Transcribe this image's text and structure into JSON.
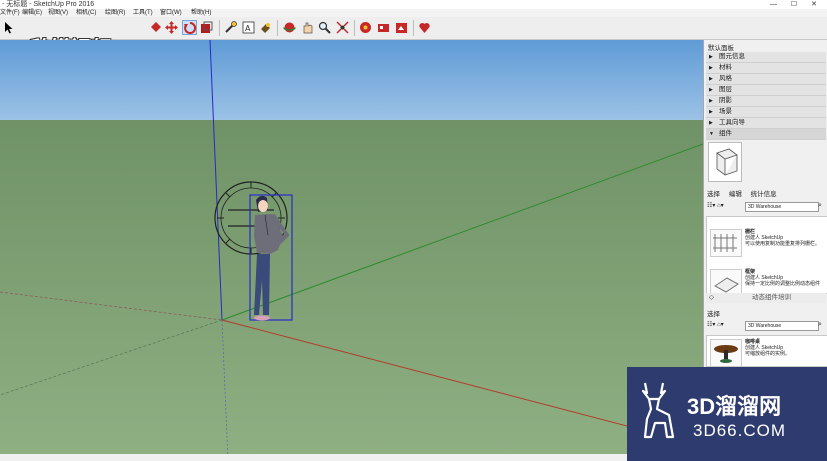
{
  "window": {
    "title": "- 无标题 - SketchUp Pro 2016"
  },
  "menu": {
    "items": [
      "文件(F)",
      "编辑(E)",
      "视图(V)",
      "相机(C)",
      "绘图(R)",
      "工具(T)",
      "窗口(W)",
      "帮助(H)"
    ]
  },
  "toolbar": {
    "logo_text": "秒懂视频",
    "tools": [
      "select-icon",
      "eraser-icon",
      "paint-bucket-icon",
      "move-icon",
      "rotate-icon",
      "scale-icon",
      "tape-measure-icon",
      "text-icon",
      "paint-icon",
      "orbit-icon",
      "pan-icon",
      "zoom-icon",
      "zoom-extents-icon",
      "warehouse-icon",
      "extension-icon",
      "share-icon",
      "layout-icon"
    ]
  },
  "panel": {
    "title": "默认面板",
    "trays": [
      {
        "label": "图元信息",
        "open": false
      },
      {
        "label": "材料",
        "open": false
      },
      {
        "label": "风格",
        "open": false
      },
      {
        "label": "图层",
        "open": false
      },
      {
        "label": "阴影",
        "open": false
      },
      {
        "label": "场景",
        "open": false
      },
      {
        "label": "工具向导",
        "open": false
      },
      {
        "label": "组件",
        "open": true
      }
    ],
    "tabs": [
      "选择",
      "编辑",
      "统计信息"
    ],
    "search_value": "3D Warehouse",
    "components": [
      {
        "name": "栅栏",
        "author": "创建人 SketchUp",
        "desc": "可以使用复制功能重复排列栅栏。"
      },
      {
        "name": "框架",
        "author": "创建人 SketchUp",
        "desc": "保持一定比例的调整比例动态组件"
      }
    ],
    "dynamic_label": "动态组件培训",
    "select2_label": "选择",
    "search2_value": "3D Warehouse",
    "components2": [
      {
        "name": "咖啡桌",
        "author": "创建人 SketchUp",
        "desc": "可缩放组件的实例。"
      }
    ]
  },
  "brand_watermark": {
    "line1": "3D溜溜网",
    "line2": "3D66.COM"
  },
  "colors": {
    "sky": "#6fa8dc",
    "ground": "#7f9f73",
    "axis_red": "#b33a2a",
    "axis_green": "#2e8b2e",
    "axis_blue": "#2a2ac4"
  }
}
